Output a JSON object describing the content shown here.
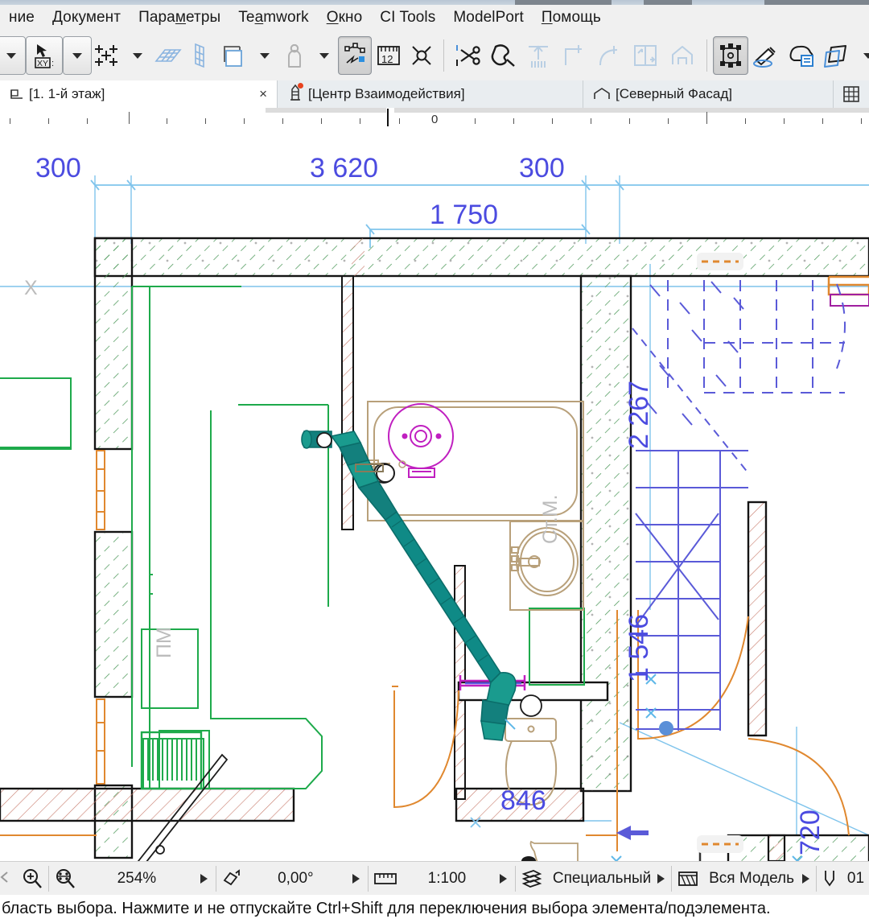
{
  "menu": {
    "items": [
      {
        "name": "menu-edit",
        "label": "ние",
        "pre": "",
        "mn": "",
        "post": "ние"
      },
      {
        "name": "menu-document",
        "label": "Документ",
        "pre": "",
        "mn": "Д",
        "post": "окумент"
      },
      {
        "name": "menu-parameters",
        "label": "Параметры",
        "pre": "Пара",
        "mn": "м",
        "post": "етры"
      },
      {
        "name": "menu-teamwork",
        "label": "Teamwork",
        "pre": "Te",
        "mn": "a",
        "post": "mwork"
      },
      {
        "name": "menu-window",
        "label": "Окно",
        "pre": "",
        "mn": "О",
        "post": "кно"
      },
      {
        "name": "menu-ci-tools",
        "label": "CI Tools",
        "pre": "CI Tools",
        "mn": "",
        "post": ""
      },
      {
        "name": "menu-modelport",
        "label": "ModelPort",
        "pre": "ModelPort",
        "mn": "",
        "post": ""
      },
      {
        "name": "menu-help",
        "label": "Помощь",
        "pre": "",
        "mn": "П",
        "post": "омощь"
      }
    ]
  },
  "toolbar": {
    "buttons": [
      {
        "name": "dropdown-left-caret",
        "icon": "caret-down-icon",
        "type": "caret"
      },
      {
        "name": "coordinate-xy-button",
        "icon": "xy-cursor-icon",
        "type": "framed"
      },
      {
        "name": "coordinate-dropdown-caret",
        "icon": "caret-down-icon",
        "type": "framed-caret"
      },
      {
        "name": "snap-grid-button",
        "icon": "snap-grid-icon",
        "type": "plain"
      },
      {
        "name": "snap-grid-caret",
        "icon": "caret-down-icon",
        "type": "caret"
      },
      {
        "name": "grid-plane-button",
        "icon": "grid-plane-icon",
        "type": "plain"
      },
      {
        "name": "grid-vertical-button",
        "icon": "grid-vertical-icon",
        "type": "plain"
      },
      {
        "name": "layer-button",
        "icon": "layers-square-icon",
        "type": "plain"
      },
      {
        "name": "layer-caret",
        "icon": "caret-down-icon",
        "type": "caret"
      },
      {
        "name": "person-scale-button",
        "icon": "person-icon",
        "type": "plain"
      },
      {
        "name": "person-caret",
        "icon": "caret-down-icon",
        "type": "caret"
      },
      {
        "name": "edit-node-button",
        "icon": "node-edit-icon",
        "type": "pressed"
      },
      {
        "name": "measure-button",
        "icon": "ruler-12-icon",
        "type": "plain"
      },
      {
        "name": "marquee-button",
        "icon": "marquee-icon",
        "type": "plain"
      },
      {
        "name": "separator-1",
        "icon": "separator",
        "type": "sep"
      },
      {
        "name": "split-button",
        "icon": "scissors-icon",
        "type": "plain"
      },
      {
        "name": "magic-wand-button",
        "icon": "magic-wand-icon",
        "type": "plain"
      },
      {
        "name": "trim-button",
        "icon": "trim-icon",
        "type": "plain"
      },
      {
        "name": "adjust-button",
        "icon": "adjust-corner-icon",
        "type": "plain"
      },
      {
        "name": "fillet-button",
        "icon": "fillet-icon",
        "type": "plain"
      },
      {
        "name": "offset-button",
        "icon": "offset-icon",
        "type": "plain"
      },
      {
        "name": "multiply-button",
        "icon": "house-icon",
        "type": "plain"
      },
      {
        "name": "separator-2",
        "icon": "separator",
        "type": "sep"
      },
      {
        "name": "select-elements-button",
        "icon": "select-nodes-icon",
        "type": "pressed"
      },
      {
        "name": "paint-params-button",
        "icon": "paintbrush-icon",
        "type": "plain"
      },
      {
        "name": "favorites-button",
        "icon": "cloud-list-icon",
        "type": "plain"
      },
      {
        "name": "morph-button",
        "icon": "morph-cube-icon",
        "type": "plain"
      },
      {
        "name": "morph-caret",
        "icon": "caret-down-icon",
        "type": "caret"
      }
    ]
  },
  "tabs": {
    "items": [
      {
        "name": "tab-floor-1",
        "label": "[1. 1-й этаж]",
        "icon": "floorplan-icon",
        "active": true,
        "closable": true,
        "close_label": "×"
      },
      {
        "name": "tab-interaction-center",
        "label": "[Центр Взаимодействия]",
        "icon": "lighthouse-icon",
        "active": false,
        "closable": false,
        "badge": true
      },
      {
        "name": "tab-north-facade",
        "label": "[Северный Фасад]",
        "icon": "facade-icon",
        "active": false,
        "closable": false
      }
    ],
    "grid_button": "grid-view-icon"
  },
  "ruler": {
    "zero_label": "0"
  },
  "drawing": {
    "dimensions": {
      "top": [
        {
          "name": "dim-300-left",
          "value": "300"
        },
        {
          "name": "dim-3620",
          "value": "3 620"
        },
        {
          "name": "dim-300-right",
          "value": "300"
        },
        {
          "name": "dim-1750",
          "value": "1 750"
        }
      ],
      "right": [
        {
          "name": "dim-2267",
          "value": "2 267"
        },
        {
          "name": "dim-1546",
          "value": "1 546"
        },
        {
          "name": "dim-720",
          "value": "720"
        }
      ],
      "bottom": [
        {
          "name": "dim-846",
          "value": "846"
        }
      ]
    },
    "labels": [
      {
        "name": "room-label-x",
        "value": "X"
      },
      {
        "name": "room-label-pm",
        "value": "ПМ"
      },
      {
        "name": "room-label-washer",
        "value": "Ст.М."
      }
    ],
    "colors": {
      "dimension": "#4b4be0",
      "wall_outline": "#1a1a1a",
      "wall_hatch": "#3f8f4f",
      "partition_hatch": "#c06a5a",
      "zone_green": "#1eaa4b",
      "furniture_tan": "#b8a07a",
      "fixture_magenta": "#c01fc0",
      "door_orange": "#e08a35",
      "stair_blue": "#5a5ad8",
      "marquee_cyan": "#5fb8e8",
      "highlight_teal": "#108a86",
      "label_gray": "#bcbcbc"
    }
  },
  "status": {
    "items": [
      {
        "name": "zoom-in-tool",
        "icon": "zoom-in-icon",
        "type": "icon"
      },
      {
        "name": "fit-in-window-tool",
        "icon": "fit-window-icon",
        "type": "icon"
      },
      {
        "name": "zoom-level",
        "value": "254%",
        "type": "value"
      },
      {
        "name": "zoom-level-arrow",
        "icon": "play-arrow-icon",
        "type": "arrow"
      },
      {
        "name": "orientation-icon",
        "icon": "rotate-icon",
        "type": "icon"
      },
      {
        "name": "orientation-angle",
        "value": "0,00°",
        "type": "value"
      },
      {
        "name": "orientation-arrow",
        "icon": "play-arrow-icon",
        "type": "arrow"
      },
      {
        "name": "scale-icon",
        "icon": "ruler-icon",
        "type": "icon"
      },
      {
        "name": "drawing-scale",
        "value": "1:100",
        "type": "value"
      },
      {
        "name": "drawing-scale-arrow",
        "icon": "play-arrow-icon",
        "type": "arrow"
      },
      {
        "name": "layer-combination-icon",
        "icon": "layers-icon",
        "type": "icon"
      },
      {
        "name": "layer-combination",
        "value": "Специальный",
        "type": "value"
      },
      {
        "name": "layer-combination-arrow",
        "icon": "play-arrow-icon",
        "type": "arrow"
      },
      {
        "name": "structure-display-icon",
        "icon": "structure-icon",
        "type": "icon"
      },
      {
        "name": "structure-display",
        "value": "Вся Модель",
        "type": "value"
      },
      {
        "name": "structure-display-arrow",
        "icon": "play-arrow-icon",
        "type": "arrow"
      },
      {
        "name": "pen-set-icon",
        "icon": "pen-icon",
        "type": "icon"
      },
      {
        "name": "pen-set-value",
        "value": "01",
        "type": "value"
      }
    ],
    "message": "бласть выбора. Нажмите и не отпускайте Ctrl+Shift для переключения выбора элемента/подэлемента."
  }
}
